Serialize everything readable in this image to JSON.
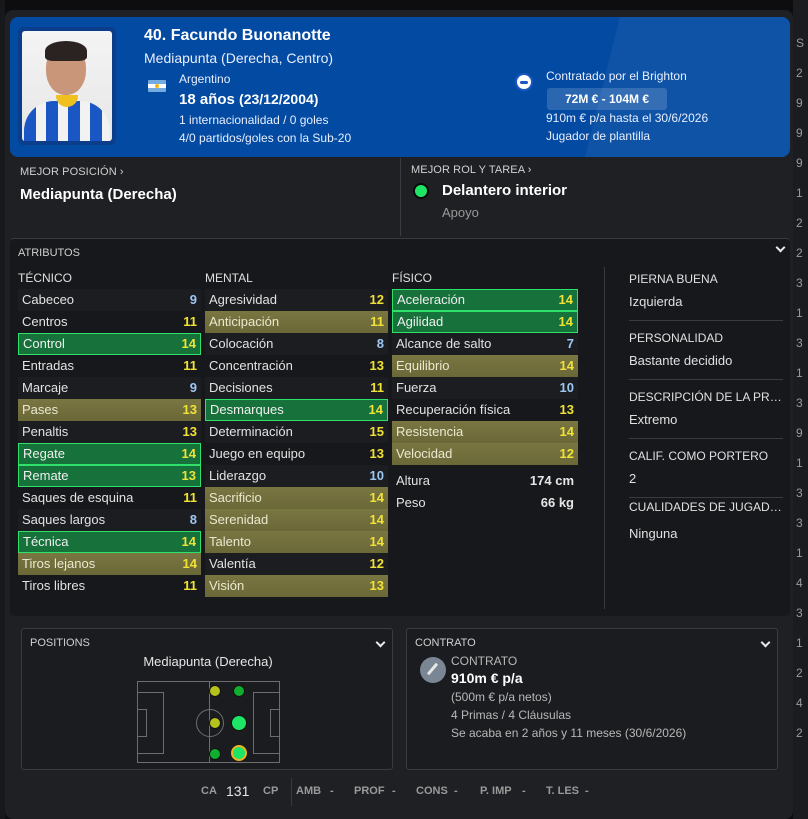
{
  "header": {
    "name": "40. Facundo Buonanotte",
    "positions": "Mediapunta (Derecha, Centro)",
    "nationality": "Argentino",
    "age": "18 años",
    "dob": "(23/12/2004)",
    "international": "1 internacionalidad / 0 goles",
    "youth": "4/0 partidos/goles con la Sub-20",
    "contracted_by": "Contratado por el Brighton",
    "value_range": "72M € - 104M €",
    "wage_until": "910m € p/a hasta el 30/6/2026",
    "squad_status": "Jugador de plantilla",
    "brand_color": "#034aa3"
  },
  "best_position": {
    "label": "MEJOR POSICIÓN ›",
    "value": "Mediapunta (Derecha)"
  },
  "best_role": {
    "label": "MEJOR ROL Y TAREA ›",
    "role": "Delantero interior",
    "duty": "Apoyo",
    "indicator_color": "#1ee565"
  },
  "attributes": {
    "title": "ATRIBUTOS",
    "technical": {
      "header": "TÉCNICO",
      "items": [
        {
          "name": "Cabeceo",
          "value": "9",
          "hl": "",
          "color": "blue"
        },
        {
          "name": "Centros",
          "value": "11",
          "hl": "",
          "color": "yellow"
        },
        {
          "name": "Control",
          "value": "14",
          "hl": "green",
          "color": "yellow"
        },
        {
          "name": "Entradas",
          "value": "11",
          "hl": "",
          "color": "yellow"
        },
        {
          "name": "Marcaje",
          "value": "9",
          "hl": "",
          "color": "blue"
        },
        {
          "name": "Pases",
          "value": "13",
          "hl": "olive",
          "color": "yellow"
        },
        {
          "name": "Penaltis",
          "value": "13",
          "hl": "",
          "color": "yellow"
        },
        {
          "name": "Regate",
          "value": "14",
          "hl": "green",
          "color": "yellow"
        },
        {
          "name": "Remate",
          "value": "13",
          "hl": "green",
          "color": "yellow"
        },
        {
          "name": "Saques de esquina",
          "value": "11",
          "hl": "",
          "color": "yellow"
        },
        {
          "name": "Saques largos",
          "value": "8",
          "hl": "",
          "color": "blue"
        },
        {
          "name": "Técnica",
          "value": "14",
          "hl": "green",
          "color": "yellow"
        },
        {
          "name": "Tiros lejanos",
          "value": "14",
          "hl": "olive",
          "color": "yellow"
        },
        {
          "name": "Tiros libres",
          "value": "11",
          "hl": "",
          "color": "yellow"
        }
      ]
    },
    "mental": {
      "header": "MENTAL",
      "items": [
        {
          "name": "Agresividad",
          "value": "12",
          "hl": "",
          "color": "yellow"
        },
        {
          "name": "Anticipación",
          "value": "11",
          "hl": "olive",
          "color": "yellow"
        },
        {
          "name": "Colocación",
          "value": "8",
          "hl": "",
          "color": "blue"
        },
        {
          "name": "Concentración",
          "value": "13",
          "hl": "",
          "color": "yellow"
        },
        {
          "name": "Decisiones",
          "value": "11",
          "hl": "",
          "color": "yellow"
        },
        {
          "name": "Desmarques",
          "value": "14",
          "hl": "green",
          "color": "yellow"
        },
        {
          "name": "Determinación",
          "value": "15",
          "hl": "",
          "color": "yellow"
        },
        {
          "name": "Juego en equipo",
          "value": "13",
          "hl": "",
          "color": "yellow"
        },
        {
          "name": "Liderazgo",
          "value": "10",
          "hl": "",
          "color": "blue"
        },
        {
          "name": "Sacrificio",
          "value": "14",
          "hl": "olive",
          "color": "yellow"
        },
        {
          "name": "Serenidad",
          "value": "14",
          "hl": "olive",
          "color": "yellow"
        },
        {
          "name": "Talento",
          "value": "14",
          "hl": "olive",
          "color": "yellow"
        },
        {
          "name": "Valentía",
          "value": "12",
          "hl": "",
          "color": "yellow"
        },
        {
          "name": "Visión",
          "value": "13",
          "hl": "olive",
          "color": "yellow"
        }
      ]
    },
    "physical": {
      "header": "FÍSICO",
      "items": [
        {
          "name": "Aceleración",
          "value": "14",
          "hl": "green",
          "color": "yellow"
        },
        {
          "name": "Agilidad",
          "value": "14",
          "hl": "green",
          "color": "yellow"
        },
        {
          "name": "Alcance de salto",
          "value": "7",
          "hl": "",
          "color": "blue"
        },
        {
          "name": "Equilibrio",
          "value": "14",
          "hl": "olive",
          "color": "yellow"
        },
        {
          "name": "Fuerza",
          "value": "10",
          "hl": "",
          "color": "blue"
        },
        {
          "name": "Recuperación física",
          "value": "13",
          "hl": "",
          "color": "yellow"
        },
        {
          "name": "Resistencia",
          "value": "14",
          "hl": "olive",
          "color": "yellow"
        },
        {
          "name": "Velocidad",
          "value": "12",
          "hl": "olive",
          "color": "yellow"
        }
      ],
      "height_label": "Altura",
      "height_value": "174 cm",
      "weight_label": "Peso",
      "weight_value": "66 kg"
    },
    "info": [
      {
        "label": "PIERNA BUENA",
        "value": "Izquierda"
      },
      {
        "label": "PERSONALIDAD",
        "value": "Bastante decidido"
      },
      {
        "label": "DESCRIPCIÓN DE LA PRE...",
        "value": "Extremo"
      },
      {
        "label": "CALIF. COMO PORTERO",
        "value": "2"
      },
      {
        "label": "CUALIDADES DE JUGADOR",
        "value": "Ninguna"
      }
    ]
  },
  "positions_box": {
    "title": "POSITIONS",
    "selected_position": "Mediapunta (Derecha)"
  },
  "contract_box": {
    "title": "CONTRATO",
    "label": "CONTRATO",
    "wage": "910m € p/a",
    "net": "(500m € p/a netos)",
    "bonuses": "4 Primas / 4 Cláusulas",
    "expiry": "Se acaba en 2 años y 11 meses  (30/6/2026)"
  },
  "footer": {
    "ca_label": "CA",
    "ca_value": "131",
    "cp_label": "CP",
    "amb_label": "AMB",
    "amb_value": "-",
    "prof_label": "PROF",
    "prof_value": "-",
    "cons_label": "CONS",
    "cons_value": "-",
    "pimp_label": "P. IMP",
    "pimp_value": "-",
    "tles_label": "T. LES",
    "tles_value": "-"
  },
  "right_edge_numbers": [
    "S",
    "2",
    "9",
    "9",
    "9",
    "1",
    "2",
    "2",
    "3",
    "1",
    "3",
    "1",
    "3",
    "9",
    "1",
    "3",
    "3",
    "1",
    "4",
    "3",
    "1",
    "2",
    "4",
    "2"
  ]
}
